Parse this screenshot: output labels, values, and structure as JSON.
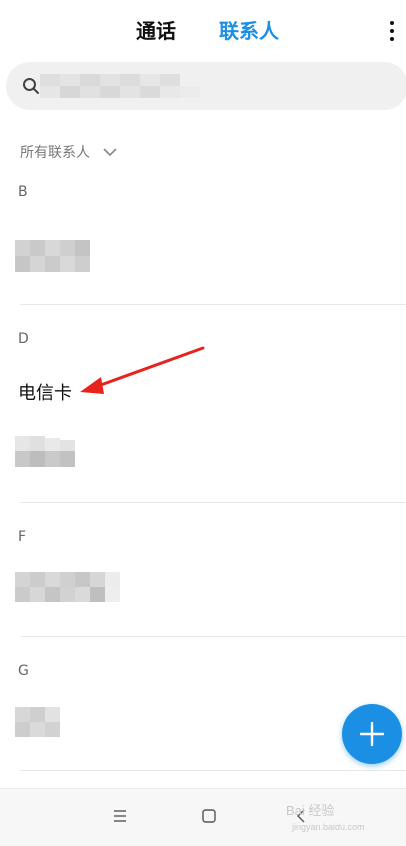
{
  "tabs": {
    "calls_label": "通话",
    "contacts_label": "联系人",
    "active": "contacts"
  },
  "menu_icon": "more-vertical-icon",
  "search": {
    "icon": "search-icon",
    "value": ""
  },
  "filter": {
    "label": "所有联系人",
    "icon": "chevron-down-icon"
  },
  "sections": [
    {
      "letter": "B",
      "contacts": []
    },
    {
      "letter": "D",
      "contacts": [
        "电信卡"
      ]
    },
    {
      "letter": "F",
      "contacts": []
    },
    {
      "letter": "G",
      "contacts": []
    }
  ],
  "fab": {
    "icon": "plus-icon"
  },
  "nav_bar": {
    "menu_icon": "menu-icon",
    "home_icon": "home-square-icon",
    "back_icon": "back-chevron-icon"
  },
  "watermark": {
    "text": "Bai 经验",
    "subtext": "jingyan.baidu.com"
  },
  "colors": {
    "accent": "#1a8fe3",
    "background": "#ffffff",
    "search_bg": "#f0f0f0",
    "annotation_arrow": "#e8231e"
  }
}
